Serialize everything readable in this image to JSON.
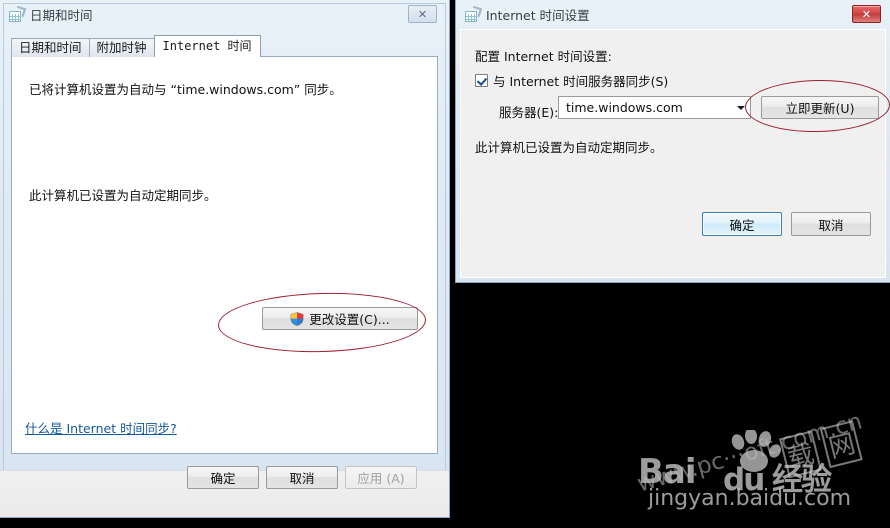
{
  "left_dialog": {
    "title": "日期和时间",
    "icon": "date-time-icon",
    "close_label": "✕",
    "tabs": [
      {
        "label": "日期和时间",
        "selected": false
      },
      {
        "label": "附加时钟",
        "selected": false
      },
      {
        "label": "Internet 时间",
        "selected": true
      }
    ],
    "line1": "已将计算机设置为自动与 “time.windows.com” 同步。",
    "line2": "此计算机已设置为自动定期同步。",
    "link": "什么是 Internet 时间同步?",
    "change_settings_button": "更改设置(C)...",
    "footer": {
      "ok": "确定",
      "cancel": "取消",
      "apply": "应用 (A)"
    }
  },
  "right_dialog": {
    "title": "Internet 时间设置",
    "icon": "date-time-icon",
    "close_label": "✕",
    "heading": "配置 Internet 时间设置:",
    "sync_checkbox_label": "与 Internet 时间服务器同步(S)",
    "sync_checkbox_checked": true,
    "server_label": "服务器(E):",
    "server_value": "time.windows.com",
    "update_button": "立即更新(U)",
    "status_line": "此计算机已设置为自动定期同步。",
    "ok": "确定",
    "cancel": "取消"
  },
  "annotations": {
    "color": "#9e1f2f",
    "ellipse_left_target": "更改设置(C)...",
    "ellipse_right_target": "立即更新(U)"
  },
  "watermark": {
    "brand": "Bai",
    "brand_tail": "du 经验",
    "url": "jingyan.baidu.com",
    "diagonal_url": "www.pc⋅⋅⋅oft.com.cn",
    "diagonal_cjk_1": "载",
    "diagonal_cjk_2": "网"
  }
}
